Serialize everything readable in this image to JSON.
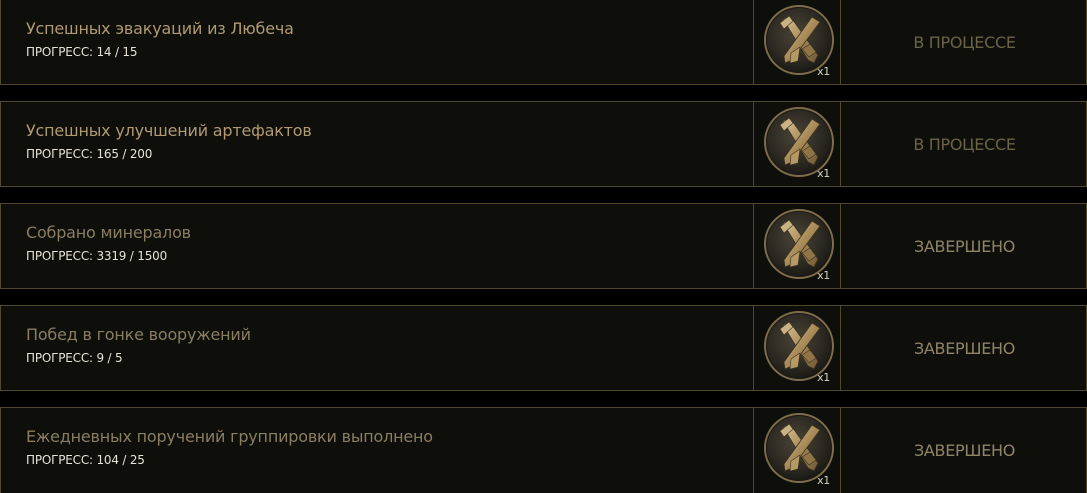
{
  "quests": [
    {
      "title": "Успешных эвакуаций из Любеча",
      "progress": "ПРОГРЕСС: 14 / 15",
      "reward_icon": "crossed-tools-icon",
      "reward_qty": "x1",
      "status": "В ПРОЦЕССЕ",
      "completed": false
    },
    {
      "title": "Успешных улучшений артефактов",
      "progress": "ПРОГРЕСС: 165 / 200",
      "reward_icon": "crossed-tools-icon",
      "reward_qty": "x1",
      "status": "В ПРОЦЕССЕ",
      "completed": false
    },
    {
      "title": "Собрано минералов",
      "progress": "ПРОГРЕСС: 3319 / 1500",
      "reward_icon": "crossed-tools-icon",
      "reward_qty": "x1",
      "status": "ЗАВЕРШЕНО",
      "completed": true
    },
    {
      "title": "Побед в гонке вооружений",
      "progress": "ПРОГРЕСС: 9 / 5",
      "reward_icon": "crossed-tools-icon",
      "reward_qty": "x1",
      "status": "ЗАВЕРШЕНО",
      "completed": true
    },
    {
      "title": "Ежедневных поручений группировки выполнено",
      "progress": "ПРОГРЕСС: 104 / 25",
      "reward_icon": "crossed-tools-icon",
      "reward_qty": "x1",
      "status": "ЗАВЕРШЕНО",
      "completed": true
    }
  ],
  "colors": {
    "background": "#000000",
    "row_background": "#0e0e0b",
    "border": "#4d4a2b",
    "title_active": "#b09a72",
    "title_done": "#8a7e62",
    "progress_text": "#e6e2d6",
    "status_in_progress": "#6a6348",
    "status_done": "#8f8566"
  }
}
